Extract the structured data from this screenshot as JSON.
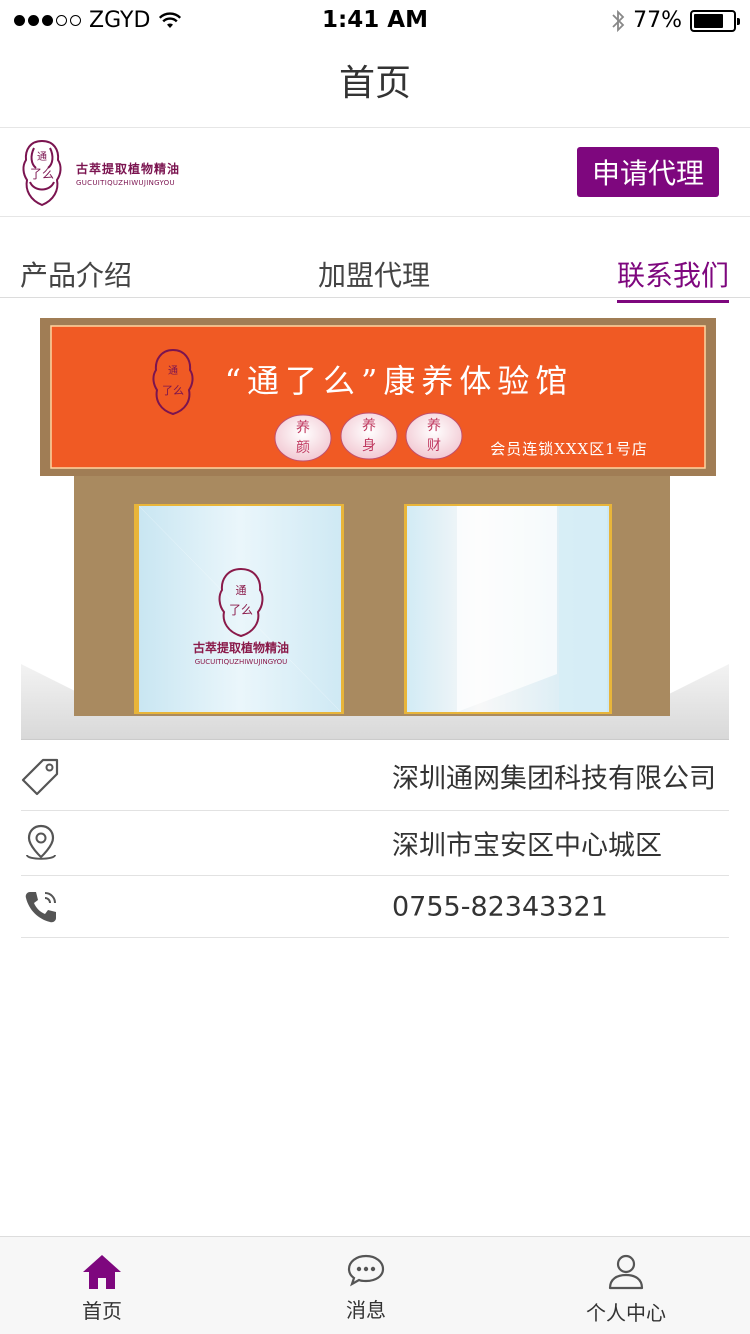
{
  "status_bar": {
    "carrier": "ZGYD",
    "time": "1:41 AM",
    "battery": "77%",
    "battery_level": 0.77,
    "icons": [
      "signal-dots-icon",
      "wifi-icon",
      "bluetooth-icon",
      "battery-icon"
    ]
  },
  "nav": {
    "title": "首页"
  },
  "brand": {
    "logo_char": "通",
    "name_cn": "古萃提取植物精油",
    "name_en": "GUCUITIQUZHIWUJINGYOU",
    "apply_label": "申请代理",
    "color": "#7e077e"
  },
  "tabs": [
    {
      "label": "产品介绍",
      "active": false
    },
    {
      "label": "加盟代理",
      "active": false
    },
    {
      "label": "联系我们",
      "active": true
    }
  ],
  "store": {
    "sign_title": "“通了么”康养体验馆",
    "badges": [
      {
        "top": "养",
        "bottom": "颜"
      },
      {
        "top": "养",
        "bottom": "身"
      },
      {
        "top": "养",
        "bottom": "财"
      }
    ],
    "branch": "会员连锁XXX区1号店",
    "window_brand_cn": "古萃提取植物精油",
    "window_brand_en": "GUCUITIQUZHIWUJINGYOU",
    "sign_color": "#f05a24"
  },
  "contact": [
    {
      "icon": "tag-icon",
      "text": "深圳通网集团科技有限公司"
    },
    {
      "icon": "location-pin-icon",
      "text": "深圳市宝安区中心城区"
    },
    {
      "icon": "phone-icon",
      "text": "0755-82343321"
    }
  ],
  "tab_bar": [
    {
      "label": "首页",
      "icon": "home-icon",
      "active": true
    },
    {
      "label": "消息",
      "icon": "message-bubble-icon",
      "active": false
    },
    {
      "label": "个人中心",
      "icon": "user-icon",
      "active": false
    }
  ]
}
